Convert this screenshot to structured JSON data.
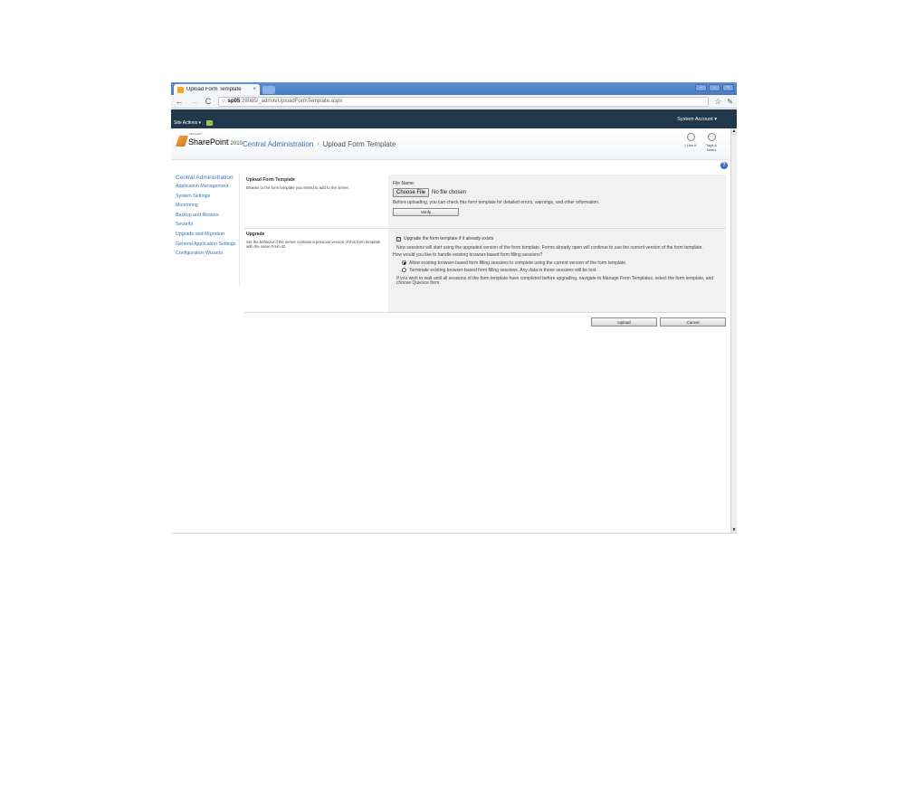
{
  "browser": {
    "tab_title": "Upload Form Template",
    "tab_close": "×",
    "url_host": "sp05",
    "url_rest": ":28085/_admin/UploadFormTemplate.aspx",
    "window_buttons": [
      "–",
      "▫",
      "×"
    ]
  },
  "ribbon": {
    "site_actions": "Site Actions ▾",
    "account": "System Account ▾"
  },
  "title_area": {
    "logo_ms": "Microsoft®",
    "logo_text": "SharePoint",
    "logo_year": "2010",
    "breadcrumb_root": "Central Administration",
    "breadcrumb_sep": "›",
    "breadcrumb_current": "Upload Form Template",
    "social": [
      {
        "label": "I Like It",
        "icon": "thumbs-up-icon"
      },
      {
        "label": "Tags & Notes",
        "icon": "tag-icon"
      }
    ],
    "help": "?"
  },
  "quick_launch": {
    "heading": "Central Administration",
    "items": [
      "Application Management",
      "System Settings",
      "Monitoring",
      "Backup and Restore",
      "Security",
      "Upgrade and Migration",
      "General Application Settings",
      "Configuration Wizards"
    ]
  },
  "form": {
    "upload": {
      "title": "Upload Form Template",
      "description": "Browse to the form template you intend to add to the server.",
      "file_label": "File Name:",
      "choose_file": "Choose File",
      "no_file": "No file chosen",
      "note": "Before uploading, you can check this form template for detailed errors, warnings, and other information.",
      "verify": "Verify"
    },
    "upgrade": {
      "title": "Upgrade",
      "description": "Set the behavior if the server contains a previous version of this form template with the same Form ID.",
      "checkbox_label": "Upgrade the form template if it already exists",
      "checkbox_checked": true,
      "note1": "New sessions will start using the upgraded version of the form template. Forms already open will continue to use the current version of the form template.",
      "question": "How would you like to handle existing browser-based form filling sessions?",
      "option_allow": "Allow existing browser-based form filling sessions to complete using the current version of the form template.",
      "option_terminate": "Terminate existing browser-based form filling sessions. Any data in those sessions will be lost.",
      "selected_option": "allow",
      "note2": "If you wish to wait until all sessions of the form template have completed before upgrading, navigate to Manage Form Templates, select the form template, and choose Quiesce form."
    },
    "buttons": {
      "upload": "Upload",
      "cancel": "Cancel"
    }
  },
  "colors": {
    "ribbon": "#21374c",
    "link": "#3b73b9",
    "browser_blue": "#4a79c0"
  }
}
